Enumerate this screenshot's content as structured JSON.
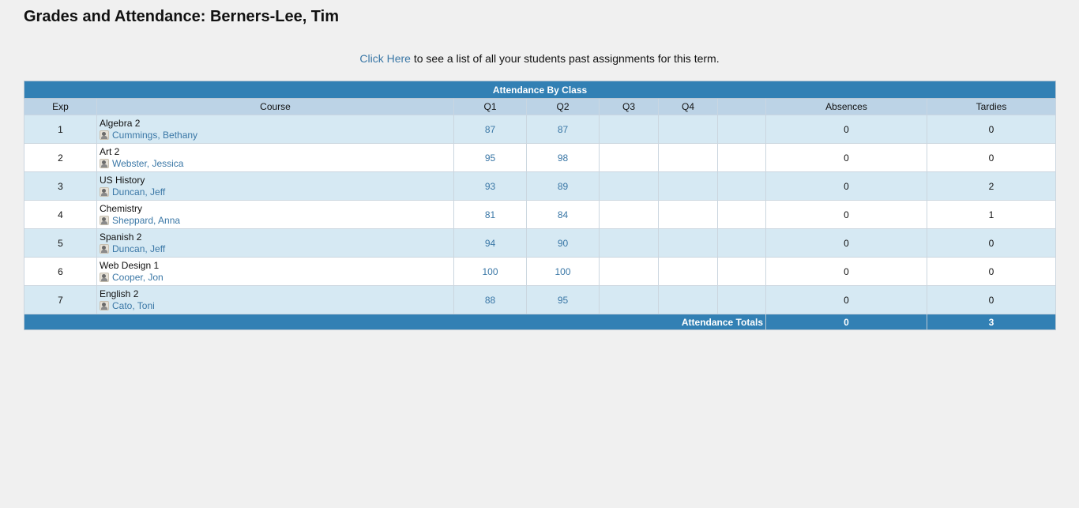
{
  "page": {
    "title": "Grades and Attendance: Berners-Lee, Tim"
  },
  "intro": {
    "link_text": "Click Here",
    "rest_text": " to see a list of all your students past assignments for this term."
  },
  "table": {
    "banner": "Attendance By Class",
    "headers": {
      "exp": "Exp",
      "course": "Course",
      "q1": "Q1",
      "q2": "Q2",
      "q3": "Q3",
      "q4": "Q4",
      "blank": "",
      "absences": "Absences",
      "tardies": "Tardies"
    },
    "rows": [
      {
        "exp": "1",
        "course": "Algebra 2",
        "teacher": "Cummings, Bethany",
        "q1": "87",
        "q2": "87",
        "q3": "",
        "q4": "",
        "extra": "",
        "absences": "0",
        "tardies": "0"
      },
      {
        "exp": "2",
        "course": "Art 2",
        "teacher": "Webster, Jessica",
        "q1": "95",
        "q2": "98",
        "q3": "",
        "q4": "",
        "extra": "",
        "absences": "0",
        "tardies": "0"
      },
      {
        "exp": "3",
        "course": "US History",
        "teacher": "Duncan, Jeff",
        "q1": "93",
        "q2": "89",
        "q3": "",
        "q4": "",
        "extra": "",
        "absences": "0",
        "tardies": "2"
      },
      {
        "exp": "4",
        "course": "Chemistry",
        "teacher": "Sheppard, Anna",
        "q1": "81",
        "q2": "84",
        "q3": "",
        "q4": "",
        "extra": "",
        "absences": "0",
        "tardies": "1"
      },
      {
        "exp": "5",
        "course": "Spanish 2",
        "teacher": "Duncan, Jeff",
        "q1": "94",
        "q2": "90",
        "q3": "",
        "q4": "",
        "extra": "",
        "absences": "0",
        "tardies": "0"
      },
      {
        "exp": "6",
        "course": "Web Design 1",
        "teacher": "Cooper, Jon",
        "q1": "100",
        "q2": "100",
        "q3": "",
        "q4": "",
        "extra": "",
        "absences": "0",
        "tardies": "0"
      },
      {
        "exp": "7",
        "course": "English 2",
        "teacher": "Cato, Toni",
        "q1": "88",
        "q2": "95",
        "q3": "",
        "q4": "",
        "extra": "",
        "absences": "0",
        "tardies": "0"
      }
    ],
    "totals": {
      "label": "Attendance Totals",
      "absences": "0",
      "tardies": "3"
    }
  },
  "icons": {
    "teacher": "teacher-icon"
  },
  "colors": {
    "banner": "#3280b4",
    "header": "#bcd3e6",
    "row_alt": "#d6e9f3",
    "link": "#3a77a6"
  }
}
